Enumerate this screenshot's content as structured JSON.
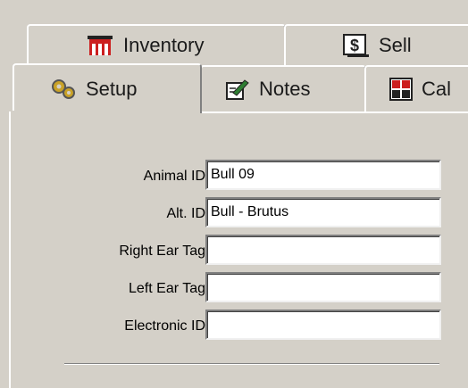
{
  "tabs_top": [
    {
      "label": "Inventory",
      "icon": "inventory-icon"
    },
    {
      "label": "Sell",
      "icon": "sell-dollar-icon"
    }
  ],
  "tabs_bottom": [
    {
      "label": "Setup",
      "icon": "gears-icon",
      "selected": true
    },
    {
      "label": "Notes",
      "icon": "notepad-pencil-icon"
    },
    {
      "label": "Cal",
      "icon": "calculator-icon"
    }
  ],
  "form": {
    "animal_id": {
      "label": "Animal ID",
      "value": "Bull 09"
    },
    "alt_id": {
      "label": "Alt. ID",
      "value": "Bull - Brutus"
    },
    "right_ear_tag": {
      "label": "Right Ear Tag",
      "value": ""
    },
    "left_ear_tag": {
      "label": "Left Ear Tag",
      "value": ""
    },
    "electronic_id": {
      "label": "Electronic ID",
      "value": ""
    }
  },
  "colors": {
    "window_bg": "#d4d0c8",
    "field_bg": "#ffffff",
    "inventory_icon_red": "#cc1f1f",
    "sell_icon_green": "#2e7d32"
  }
}
